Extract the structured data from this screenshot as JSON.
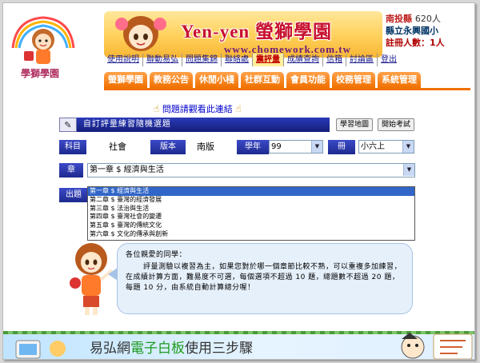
{
  "header": {
    "logo_text": "學獅學園",
    "banner_title": "Yen-yen 螢獅學園",
    "banner_url": "www.chomework.com.tw",
    "user_county": "南投縣",
    "user_count": "620人",
    "school": "縣立永興國小",
    "online_label": "註冊人數：1人"
  },
  "links": [
    {
      "label": "使用說明"
    },
    {
      "label": "聯動易弘"
    },
    {
      "label": "問題集錦"
    },
    {
      "label": "聯絡處"
    },
    {
      "label": "震評量",
      "highlight": true
    },
    {
      "label": "成績查詢"
    },
    {
      "label": "信箱"
    },
    {
      "label": "討論區"
    },
    {
      "label": "登出"
    }
  ],
  "tabs": [
    {
      "label": "螢獅學園"
    },
    {
      "label": "教務公告"
    },
    {
      "label": "休閒小棧"
    },
    {
      "label": "社群互動"
    },
    {
      "label": "會員功能"
    },
    {
      "label": "校務管理"
    },
    {
      "label": "系統管理"
    }
  ],
  "notice": {
    "text": "問題請觀看此連結"
  },
  "exam": {
    "bar_title": "自訂評量練習隨機選題",
    "btn_map": "學習地圖",
    "btn_start": "開始考試"
  },
  "form": {
    "subject_label": "科目",
    "subject_value": "社會",
    "version_label": "版本",
    "version_value": "南版",
    "year_label": "學年",
    "year_value": "99",
    "book_label": "冊",
    "book_value": "小六上",
    "chapter_label": "章",
    "chapter_value": "第一章 $ 經濟與生活",
    "out_label": "出題"
  },
  "chapter_options": [
    "第一章 $ 經濟與生活",
    "第二章 $ 臺灣的經濟發展",
    "第三章 $ 法治與生活",
    "第四章 $ 臺灣社會的變遷",
    "第五章 $ 臺灣的傳統文化",
    "第六章 $ 文化的傳承與創新"
  ],
  "message": {
    "greeting": "各位親愛的同學：",
    "body": "評量測驗以複習為主，如果您對於哪一個章節比較不熟，可以重複多加練習，在成績計算方面，難易度不可選，每個選項不超過 10 題，總題數不超過 20 題，每題 10 分，由系統自動計算總分喔！"
  },
  "ad": {
    "prefix": "易弘網",
    "green": "電子白板",
    "suffix": "使用三步驟"
  },
  "colors": {
    "accent_orange": "#f07000",
    "label_blue": "#1e2a8e",
    "selection_blue": "#3166c8"
  }
}
